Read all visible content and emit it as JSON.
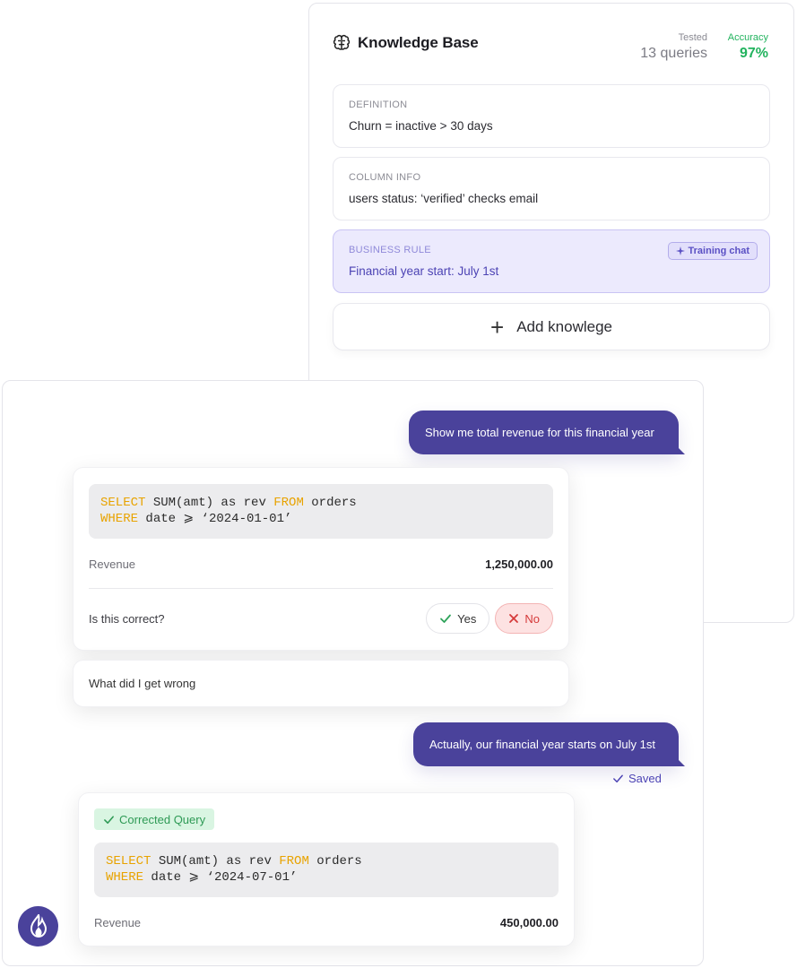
{
  "knowledge_base": {
    "title": "Knowledge Base",
    "icon": "brain-icon",
    "tested_label": "Tested",
    "tested_value": "13 queries",
    "accuracy_label": "Accuracy",
    "accuracy_value": "97%",
    "cards": [
      {
        "title": "DEFINITION",
        "text": "Churn = inactive > 30 days"
      },
      {
        "title": "COLUMN INFO",
        "text": "users status: ‘verified’ checks email"
      },
      {
        "title": "BUSINESS RULE",
        "text": "Financial year start: July 1st",
        "chip": "Training chat"
      }
    ],
    "add_label": "Add knowlege"
  },
  "chat": {
    "user_message_1": "Show me total revenue for this financial year",
    "response_1": {
      "code_line1_kw1": "SELECT",
      "code_line1_mid": " SUM(amt) as rev ",
      "code_line1_kw2": "FROM",
      "code_line1_end": " orders",
      "code_line2_kw": "WHERE",
      "code_line2_end": " date ⩾ ‘2024-01-01’",
      "result_label": "Revenue",
      "result_value": "1,250,000.00",
      "question": "Is this correct?",
      "yes_label": "Yes",
      "no_label": "No"
    },
    "wrong_prompt": "What did I get wrong",
    "user_message_2": "Actually, our financial year starts on July 1st",
    "saved_label": "Saved",
    "response_2": {
      "badge": "Corrected Query",
      "code_line1_kw1": "SELECT",
      "code_line1_mid": " SUM(amt) as rev ",
      "code_line1_kw2": "FROM",
      "code_line1_end": " orders",
      "code_line2_kw": "WHERE",
      "code_line2_end": " date ⩾ ‘2024-07-01’",
      "result_label": "Revenue",
      "result_value": "450,000.00"
    }
  },
  "colors": {
    "accent": "#4a429b",
    "success": "#22b35e",
    "danger": "#d53a3a",
    "code_keyword": "#e8a300"
  }
}
